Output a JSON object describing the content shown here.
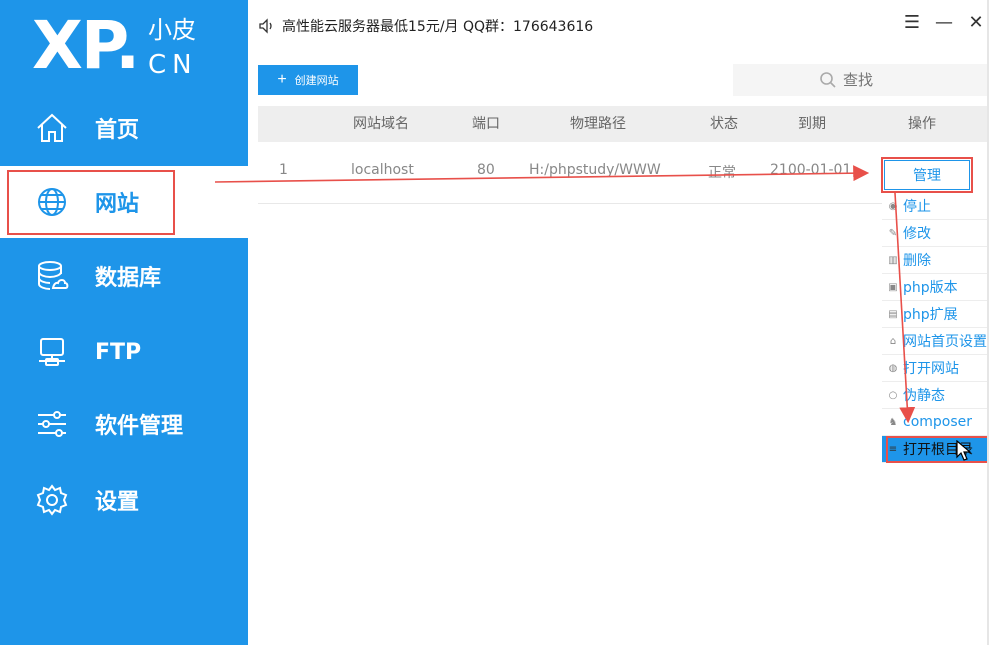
{
  "logo": {
    "main": "XP.",
    "cn_top": "小皮",
    "cn_bottom": "CN"
  },
  "nav": [
    {
      "label": "首页",
      "icon": "home-icon"
    },
    {
      "label": "网站",
      "icon": "globe-icon",
      "active": true
    },
    {
      "label": "数据库",
      "icon": "database-icon"
    },
    {
      "label": "FTP",
      "icon": "ftp-icon"
    },
    {
      "label": "软件管理",
      "icon": "sliders-icon"
    },
    {
      "label": "设置",
      "icon": "gear-icon"
    }
  ],
  "topbar": {
    "notice": "高性能云服务器最低15元/月  QQ群：176643616"
  },
  "window_controls": {
    "menu": "☰",
    "minimize": "—",
    "close": "✕"
  },
  "toolbar": {
    "create_label": "创建网站",
    "search_placeholder": "查找"
  },
  "table": {
    "headers": [
      "网站域名",
      "端口",
      "物理路径",
      "状态",
      "到期",
      "操作"
    ],
    "rows": [
      {
        "index": "1",
        "domain": "localhost",
        "port": "80",
        "path": "H:/phpstudy/WWW",
        "status": "正常",
        "expiry": "2100-01-01"
      }
    ]
  },
  "manage_label": "管理",
  "menu": [
    {
      "label": "停止",
      "icon": "stop-icon"
    },
    {
      "label": "修改",
      "icon": "edit-icon"
    },
    {
      "label": "删除",
      "icon": "trash-icon"
    },
    {
      "label": "php版本",
      "icon": "php-version-icon"
    },
    {
      "label": "php扩展",
      "icon": "php-extension-icon"
    },
    {
      "label": "网站首页设置",
      "icon": "homepage-icon"
    },
    {
      "label": "打开网站",
      "icon": "open-site-icon"
    },
    {
      "label": "伪静态",
      "icon": "rewrite-icon"
    },
    {
      "label": "composer",
      "icon": "composer-icon"
    },
    {
      "label": "打开根目录",
      "icon": "folder-icon",
      "active": true
    }
  ],
  "colors": {
    "primary": "#1e95e9",
    "annotation": "#e8504a",
    "header_bg": "#eeeeee"
  }
}
